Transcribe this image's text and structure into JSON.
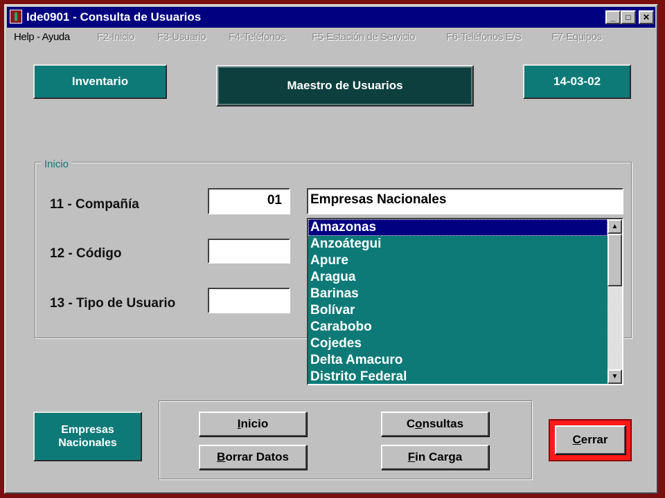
{
  "window": {
    "title": "Ide0901 - Consulta de Usuarios",
    "minimize_glyph": "_",
    "maximize_glyph": "□",
    "close_glyph": "✕"
  },
  "menu": [
    {
      "label": "Help - Ayuda",
      "enabled": true
    },
    {
      "label": "F2-Inicio",
      "enabled": false
    },
    {
      "label": "F3-Usuario",
      "enabled": false
    },
    {
      "label": "F4-Teléfonos",
      "enabled": false
    },
    {
      "label": "F5-Estación de Servicio",
      "enabled": false
    },
    {
      "label": "F6-Teléfonos E/S",
      "enabled": false
    },
    {
      "label": "F7-Equipos",
      "enabled": false
    }
  ],
  "header": {
    "inventario": "Inventario",
    "maestro": "Maestro de Usuarios",
    "fecha": "14-03-02"
  },
  "inicio": {
    "title": "Inicio",
    "compania_label": "11 - Compañía",
    "compania_value": "01",
    "compania_name": "Empresas Nacionales",
    "codigo_label": "12 - Código",
    "codigo_value": "",
    "tipo_label": "13 - Tipo de Usuario",
    "tipo_value": ""
  },
  "estados": {
    "items": [
      "Amazonas",
      "Anzoátegui",
      "Apure",
      "Aragua",
      "Barinas",
      "Bolívar",
      "Carabobo",
      "Cojedes",
      "Delta Amacuro",
      "Distrito Federal"
    ],
    "selected": "Amazonas",
    "scroll_up_glyph": "▲",
    "scroll_down_glyph": "▼"
  },
  "footer": {
    "empresa_line1": "Empresas",
    "empresa_line2": "Nacionales",
    "inicio_hotkey": "I",
    "inicio_rest": "nicio",
    "consultas_first": "C",
    "consultas_hotkey": "o",
    "consultas_rest": "nsultas",
    "borrar_hotkey": "B",
    "borrar_rest": "orrar Datos",
    "fin_hotkey": "F",
    "fin_rest": "in Carga",
    "cerrar_hotkey": "C",
    "cerrar_rest": "errar"
  },
  "colors": {
    "teal": "#0d7a78",
    "dark_teal": "#0c3f3e",
    "titlebar": "#000080",
    "highlight": "#ff1a1a"
  }
}
